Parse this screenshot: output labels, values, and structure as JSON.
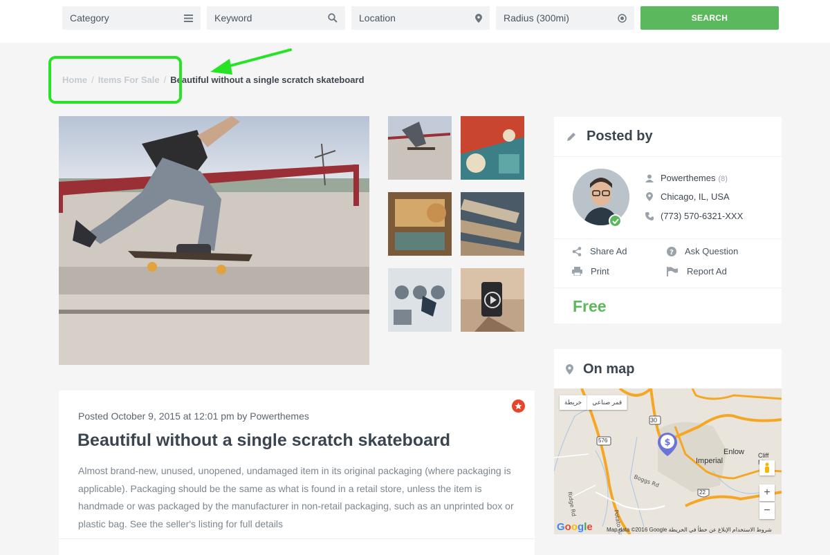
{
  "colors": {
    "accent_green": "#5cb85c",
    "highlight_green": "#27e326",
    "badge_red": "#e8442a"
  },
  "search": {
    "category_placeholder": "Category",
    "keyword_placeholder": "Keyword",
    "location_placeholder": "Location",
    "radius_placeholder": "Radius (300mi)",
    "button_label": "SEARCH"
  },
  "breadcrumb": {
    "home": "Home",
    "section": "Items For Sale",
    "separator": "/",
    "current": "Beautiful without a single scratch skateboard"
  },
  "post": {
    "meta": "Posted October 9, 2015 at 12:01 pm by Powerthemes",
    "title": "Beautiful without a single scratch skateboard",
    "body": "Almost brand-new, unused, unopened, undamaged item in its original packaging (where packaging is applicable). Packaging should be the same as what is found in a retail store, unless the item is handmade or was packaged by the manufacturer in non-retail packaging, such as an unprinted box or plastic bag. See the seller's listing for full details"
  },
  "posted_by": {
    "heading": "Posted by",
    "name": "Powerthemes",
    "count": "(8)",
    "location": "Chicago, IL, USA",
    "phone": "(773) 570-6321-XXX",
    "actions": {
      "share": "Share Ad",
      "ask": "Ask Question",
      "print": "Print",
      "report": "Report Ad"
    },
    "price": "Free"
  },
  "map": {
    "heading": "On map",
    "tab_map": "خريطة",
    "tab_satellite": "قمر صناعي",
    "labels": {
      "imperial": "Imperial",
      "enlow": "Enlow",
      "cliff_mine": "Cliff Mine",
      "road_30": "30",
      "road_576": "576",
      "road_22": "22"
    },
    "google": "Google",
    "footer": "Map data ©2016 Google   شروط الاستخدام   الإبلاغ عن خطأ في الخريطة",
    "zoom_in": "+",
    "zoom_out": "−"
  }
}
